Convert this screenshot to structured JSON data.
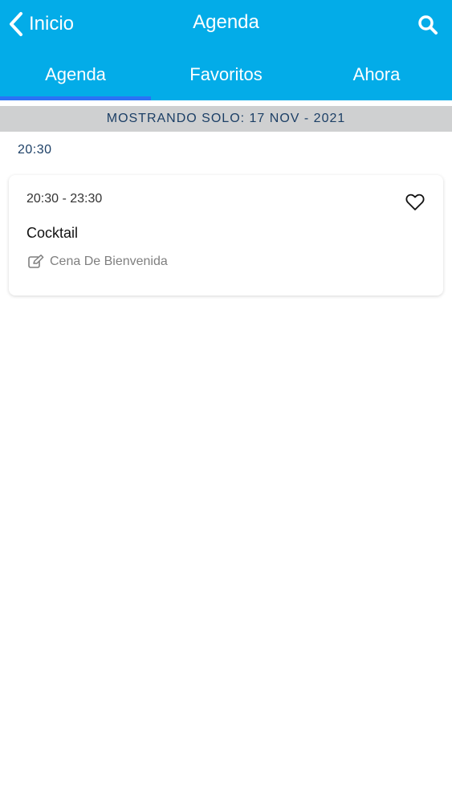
{
  "colors": {
    "primary": "#03ace8",
    "tab_indicator": "#2a73f5",
    "banner_bg": "#cfd0d1",
    "banner_text": "#1c3f66"
  },
  "header": {
    "back_label": "Inicio",
    "back_icon": "chevron-left-icon",
    "title": "Agenda",
    "search_icon": "search-icon"
  },
  "tabs": [
    {
      "label": "Agenda",
      "active": true
    },
    {
      "label": "Favoritos",
      "active": false
    },
    {
      "label": "Ahora",
      "active": false
    }
  ],
  "date_banner": "MOSTRANDO SOLO: 17 NOV - 2021",
  "time_groups": [
    {
      "time": "20:30",
      "sessions": [
        {
          "time_range": "20:30 - 23:30",
          "title": "Cocktail",
          "subtitle": "Cena De Bienvenida",
          "subtitle_icon": "edit-icon",
          "favorite_icon": "heart-outline-icon"
        }
      ]
    }
  ]
}
